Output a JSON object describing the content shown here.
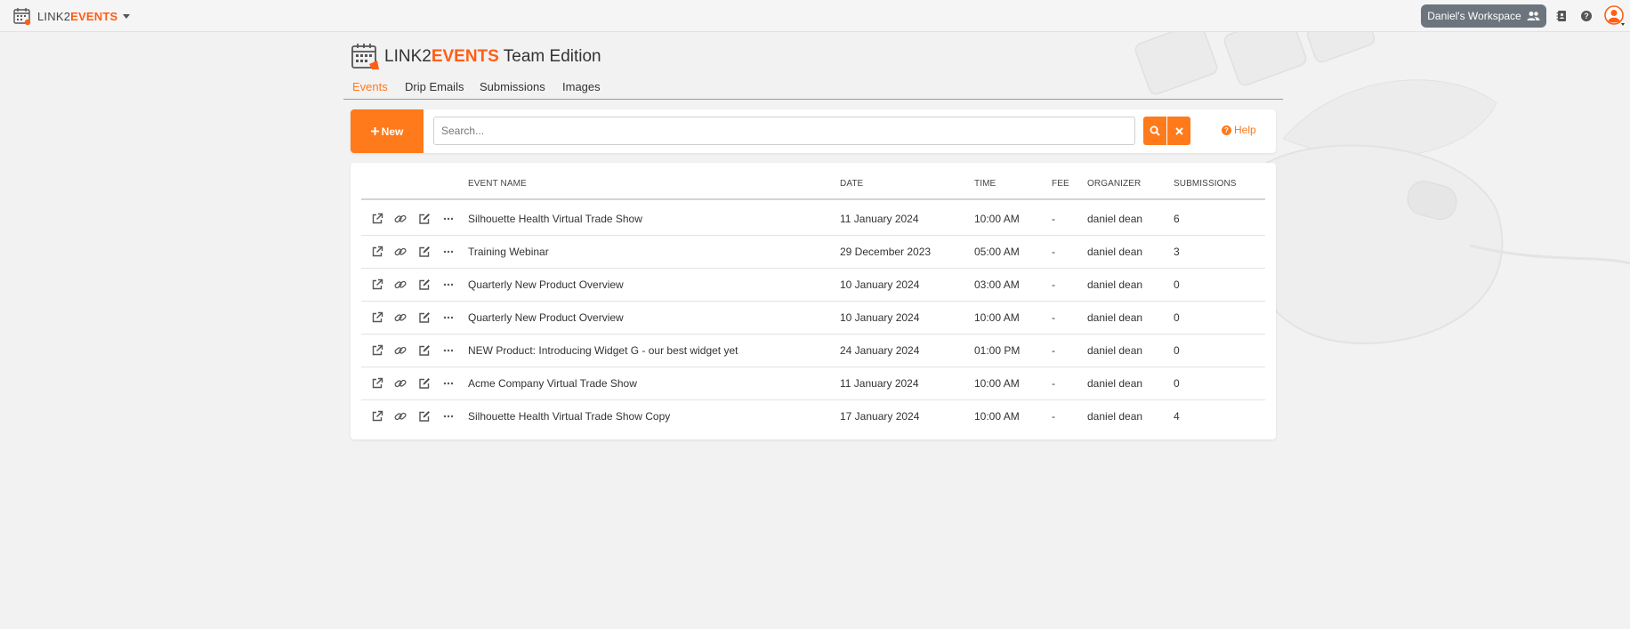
{
  "topbar": {
    "brand_prefix": "LINK2",
    "brand_accent": "EVENTS",
    "workspace_label": "Daniel's Workspace"
  },
  "header": {
    "title_prefix": "LINK2",
    "title_accent": "EVENTS",
    "title_suffix": " Team Edition"
  },
  "tabs": [
    {
      "label": "Events",
      "active": true
    },
    {
      "label": "Drip Emails",
      "active": false
    },
    {
      "label": "Submissions",
      "active": false
    },
    {
      "label": "Images",
      "active": false
    }
  ],
  "toolbar": {
    "new_label": "New",
    "search_placeholder": "Search...",
    "search_value": "",
    "help_label": "Help"
  },
  "table": {
    "columns": [
      "EVENT NAME",
      "DATE",
      "TIME",
      "FEE",
      "ORGANIZER",
      "SUBMISSIONS"
    ],
    "rows": [
      {
        "name": "Silhouette Health Virtual Trade Show",
        "date": "11 January 2024",
        "time": "10:00 AM",
        "fee": "-",
        "organizer": "daniel dean",
        "submissions": "6"
      },
      {
        "name": "Training Webinar",
        "date": "29 December 2023",
        "time": "05:00 AM",
        "fee": "-",
        "organizer": "daniel dean",
        "submissions": "3"
      },
      {
        "name": "Quarterly New Product Overview",
        "date": "10 January 2024",
        "time": "03:00 AM",
        "fee": "-",
        "organizer": "daniel dean",
        "submissions": "0"
      },
      {
        "name": "Quarterly New Product Overview",
        "date": "10 January 2024",
        "time": "10:00 AM",
        "fee": "-",
        "organizer": "daniel dean",
        "submissions": "0"
      },
      {
        "name": "NEW Product: Introducing Widget G - our best widget yet",
        "date": "24 January 2024",
        "time": "01:00 PM",
        "fee": "-",
        "organizer": "daniel dean",
        "submissions": "0"
      },
      {
        "name": "Acme Company Virtual Trade Show",
        "date": "11 January 2024",
        "time": "10:00 AM",
        "fee": "-",
        "organizer": "daniel dean",
        "submissions": "0"
      },
      {
        "name": "Silhouette Health Virtual Trade Show Copy",
        "date": "17 January 2024",
        "time": "10:00 AM",
        "fee": "-",
        "organizer": "daniel dean",
        "submissions": "4"
      }
    ]
  },
  "colors": {
    "accent": "#ff7a1a",
    "brand_orange": "#ff5e14",
    "workspace_bg": "#6c757d",
    "page_bg": "#f2f2f2"
  },
  "icons": {
    "row_actions": [
      "external-link-icon",
      "link-icon",
      "edit-icon",
      "more-icon"
    ],
    "topbar": [
      "calendar-logo-icon",
      "users-icon",
      "address-book-icon",
      "help-circle-icon",
      "user-avatar-icon"
    ]
  }
}
